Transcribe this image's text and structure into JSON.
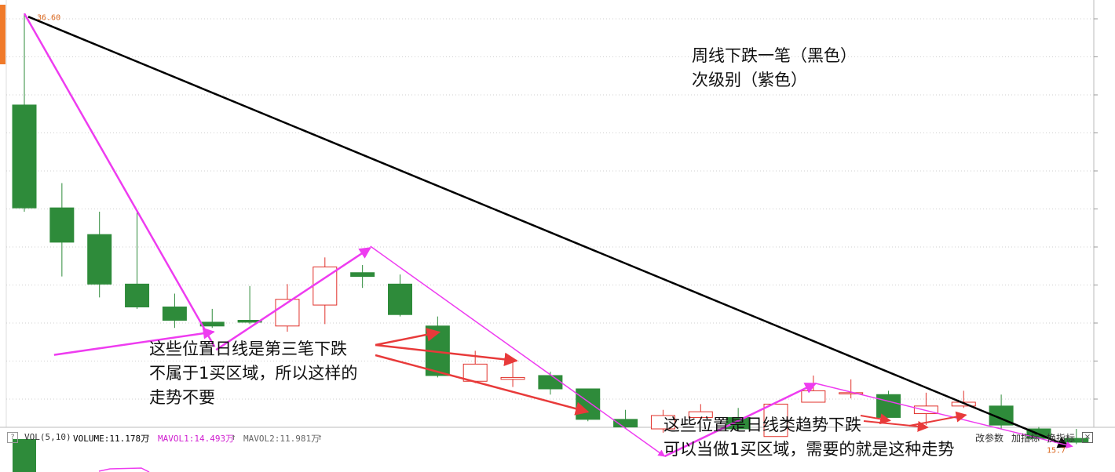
{
  "chart_data": {
    "type": "candlestick",
    "title": "",
    "xlabel": "",
    "ylabel": "",
    "ylim": [
      15.5,
      36.9
    ],
    "price_labels": {
      "high": "36.60",
      "low": "15.7"
    },
    "candles": [
      {
        "o": 31.8,
        "c": 26.4,
        "h": 36.6,
        "l": 26.2
      },
      {
        "o": 26.4,
        "c": 24.6,
        "h": 27.7,
        "l": 22.8
      },
      {
        "o": 25.0,
        "c": 22.4,
        "h": 26.2,
        "l": 21.7
      },
      {
        "o": 22.4,
        "c": 21.2,
        "h": 26.3,
        "l": 21.1
      },
      {
        "o": 21.2,
        "c": 20.5,
        "h": 21.9,
        "l": 20.1
      },
      {
        "o": 20.4,
        "c": 20.2,
        "h": 21.1,
        "l": 20.1
      },
      {
        "o": 20.5,
        "c": 20.4,
        "h": 22.3,
        "l": 20.3
      },
      {
        "o": 20.2,
        "c": 21.6,
        "h": 22.4,
        "l": 19.9
      },
      {
        "o": 21.3,
        "c": 23.3,
        "h": 23.8,
        "l": 20.3
      },
      {
        "o": 23.0,
        "c": 22.8,
        "h": 23.4,
        "l": 22.2
      },
      {
        "o": 22.4,
        "c": 20.8,
        "h": 22.9,
        "l": 20.7
      },
      {
        "o": 20.2,
        "c": 17.6,
        "h": 20.7,
        "l": 17.5
      },
      {
        "o": 17.3,
        "c": 18.2,
        "h": 18.9,
        "l": 17.2
      },
      {
        "o": 17.4,
        "c": 17.5,
        "h": 18.5,
        "l": 17.0
      },
      {
        "o": 17.6,
        "c": 16.9,
        "h": 17.8,
        "l": 16.6
      },
      {
        "o": 16.9,
        "c": 15.3,
        "h": 16.9,
        "l": 15.2
      },
      {
        "o": 15.3,
        "c": 14.9,
        "h": 15.8,
        "l": 14.8
      },
      {
        "o": 14.8,
        "c": 15.5,
        "h": 15.8,
        "l": 14.6
      },
      {
        "o": 15.4,
        "c": 15.7,
        "h": 16.1,
        "l": 15.3
      },
      {
        "o": 15.4,
        "c": 14.8,
        "h": 15.9,
        "l": 14.7
      },
      {
        "o": 14.4,
        "c": 16.1,
        "h": 16.1,
        "l": 14.4
      },
      {
        "o": 16.2,
        "c": 16.8,
        "h": 17.6,
        "l": 16.2
      },
      {
        "o": 16.7,
        "c": 16.7,
        "h": 17.4,
        "l": 16.4
      },
      {
        "o": 16.6,
        "c": 15.4,
        "h": 16.8,
        "l": 15.4
      },
      {
        "o": 15.6,
        "c": 16.0,
        "h": 16.7,
        "l": 15.0
      },
      {
        "o": 16.0,
        "c": 16.2,
        "h": 16.8,
        "l": 15.9
      },
      {
        "o": 16.0,
        "c": 15.0,
        "h": 16.6,
        "l": 14.8
      },
      {
        "o": 14.8,
        "c": 14.3,
        "h": 14.9,
        "l": 14.2
      },
      {
        "o": 14.3,
        "c": 14.1,
        "h": 14.8,
        "l": 14.0
      }
    ],
    "volume_legend": {
      "label": "VOL(5,10)",
      "volume": "VOLUME:11.178万",
      "mavol1": "MAVOL1:14.493万",
      "mavol2": "MAVOL2:11.981万"
    }
  },
  "toolbar": {
    "help_icon": "?",
    "change_params": "改参数",
    "add_indicator": "加指标",
    "switch_indicator": "换指标",
    "close_icon": "×"
  },
  "annotations": {
    "legend_line1": "周线下跌一笔（黑色）",
    "legend_line2": "次级别（紫色）",
    "left_note_line1": "这些位置日线是第三笔下跌",
    "left_note_line2": "不属于1买区域，所以这样的",
    "left_note_line3": "走势不要",
    "right_note_line1": "这些位置是日线类趋势下跌",
    "right_note_line2": "可以当做1买区域，需要的就是这种走势"
  },
  "colors": {
    "up": "#e0302a",
    "down": "#2e8b3a",
    "black_stroke": "#000000",
    "purple_stroke": "#ee3cf0",
    "red_arrow": "#e83a3a",
    "grid": "#cfcfcf"
  }
}
